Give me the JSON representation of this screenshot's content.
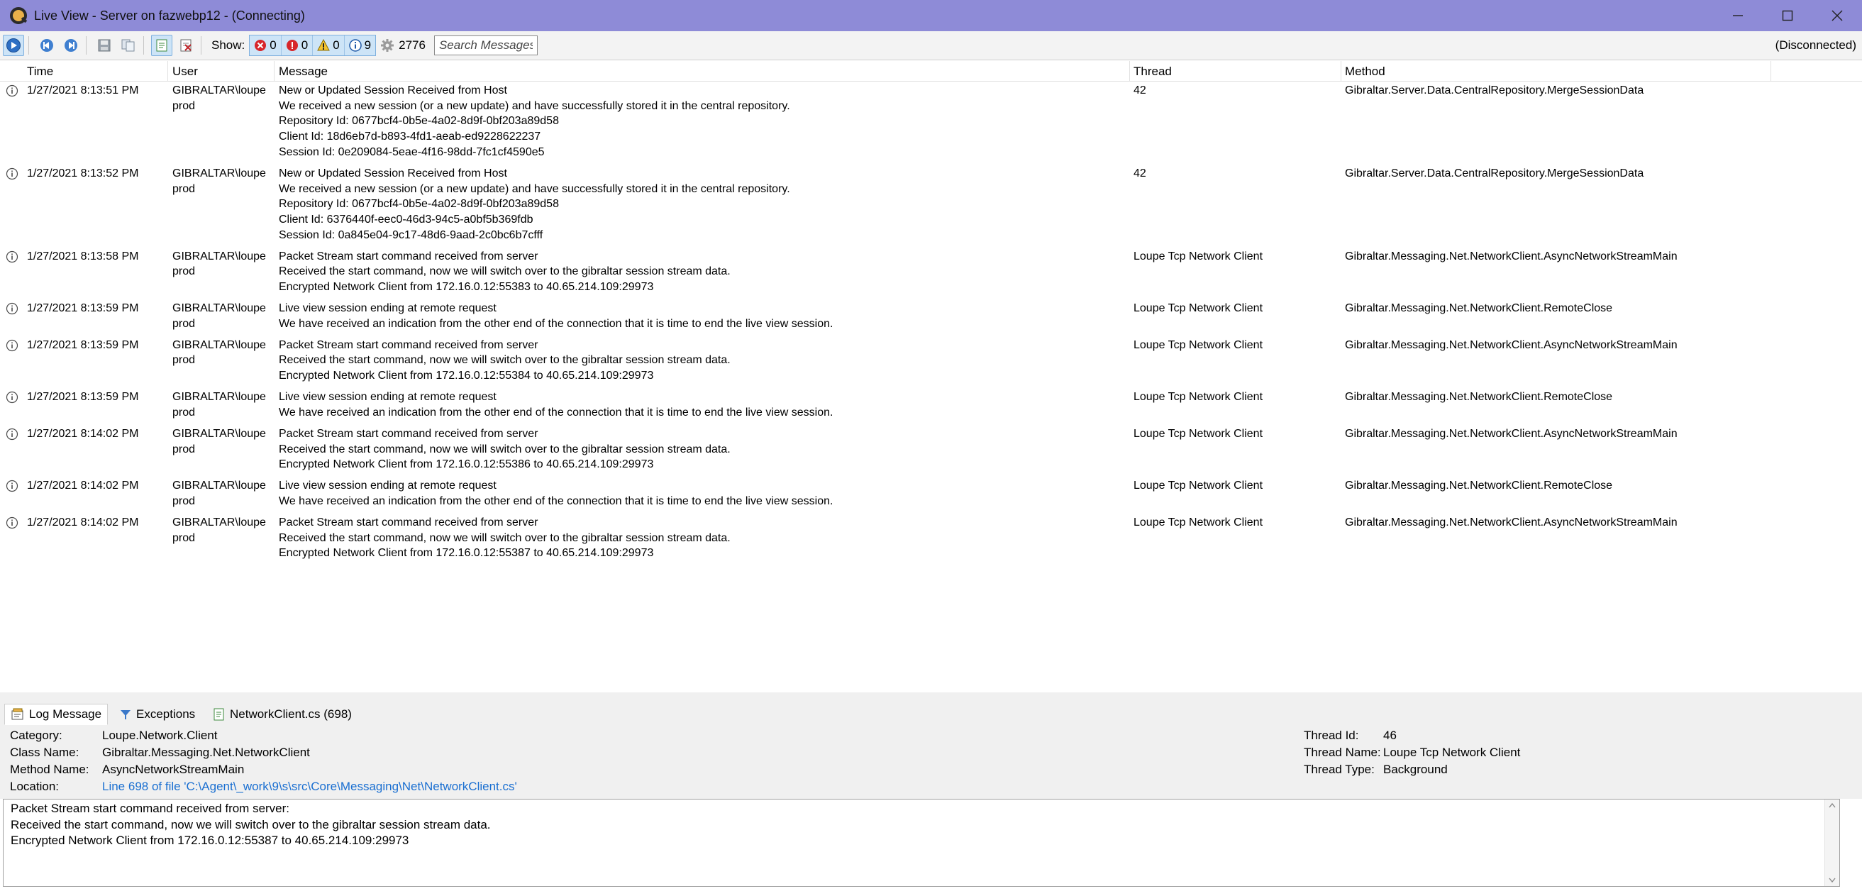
{
  "window": {
    "title": "Live View - Server on fazwebp12 - (Connecting)"
  },
  "toolbar": {
    "show_label": "Show:",
    "filters": {
      "errors": "0",
      "criticals": "0",
      "warnings": "0",
      "info": "9"
    },
    "message_count": "2776",
    "search_placeholder": "Search Messages",
    "status": "(Disconnected)"
  },
  "columns": {
    "time": "Time",
    "user": "User",
    "message": "Message",
    "thread": "Thread",
    "method": "Method"
  },
  "rows": [
    {
      "time": "1/27/2021 8:13:51 PM",
      "user": [
        "GIBRALTAR\\loupe",
        "prod"
      ],
      "message": [
        "New or Updated Session Received from Host",
        "We received a new session (or a new update) and have successfully stored it in the central repository.",
        "Repository Id: 0677bcf4-0b5e-4a02-8d9f-0bf203a89d58",
        "Client Id: 18d6eb7d-b893-4fd1-aeab-ed9228622237",
        "Session Id: 0e209084-5eae-4f16-98dd-7fc1cf4590e5"
      ],
      "thread": "42",
      "method": "Gibraltar.Server.Data.CentralRepository.MergeSessionData"
    },
    {
      "time": "1/27/2021 8:13:52 PM",
      "user": [
        "GIBRALTAR\\loupe",
        "prod"
      ],
      "message": [
        "New or Updated Session Received from Host",
        "We received a new session (or a new update) and have successfully stored it in the central repository.",
        "Repository Id: 0677bcf4-0b5e-4a02-8d9f-0bf203a89d58",
        "Client Id: 6376440f-eec0-46d3-94c5-a0bf5b369fdb",
        "Session Id: 0a845e04-9c17-48d6-9aad-2c0bc6b7cfff"
      ],
      "thread": "42",
      "method": "Gibraltar.Server.Data.CentralRepository.MergeSessionData"
    },
    {
      "time": "1/27/2021 8:13:58 PM",
      "user": [
        "GIBRALTAR\\loupe",
        "prod"
      ],
      "message": [
        "Packet Stream start command received from server",
        "Received the start command, now we will switch over to the gibraltar session stream data.",
        "Encrypted Network Client from 172.16.0.12:55383 to 40.65.214.109:29973"
      ],
      "thread": "Loupe Tcp Network Client",
      "method": "Gibraltar.Messaging.Net.NetworkClient.AsyncNetworkStreamMain"
    },
    {
      "time": "1/27/2021 8:13:59 PM",
      "user": [
        "GIBRALTAR\\loupe",
        "prod"
      ],
      "message": [
        "Live view session ending at remote request",
        "We have received an indication from the other end of the connection that it is time to end the live view session."
      ],
      "thread": "Loupe Tcp Network Client",
      "method": "Gibraltar.Messaging.Net.NetworkClient.RemoteClose"
    },
    {
      "time": "1/27/2021 8:13:59 PM",
      "user": [
        "GIBRALTAR\\loupe",
        "prod"
      ],
      "message": [
        "Packet Stream start command received from server",
        "Received the start command, now we will switch over to the gibraltar session stream data.",
        "Encrypted Network Client from 172.16.0.12:55384 to 40.65.214.109:29973"
      ],
      "thread": "Loupe Tcp Network Client",
      "method": "Gibraltar.Messaging.Net.NetworkClient.AsyncNetworkStreamMain"
    },
    {
      "time": "1/27/2021 8:13:59 PM",
      "user": [
        "GIBRALTAR\\loupe",
        "prod"
      ],
      "message": [
        "Live view session ending at remote request",
        "We have received an indication from the other end of the connection that it is time to end the live view session."
      ],
      "thread": "Loupe Tcp Network Client",
      "method": "Gibraltar.Messaging.Net.NetworkClient.RemoteClose"
    },
    {
      "time": "1/27/2021 8:14:02 PM",
      "user": [
        "GIBRALTAR\\loupe",
        "prod"
      ],
      "message": [
        "Packet Stream start command received from server",
        "Received the start command, now we will switch over to the gibraltar session stream data.",
        "Encrypted Network Client from 172.16.0.12:55386 to 40.65.214.109:29973"
      ],
      "thread": "Loupe Tcp Network Client",
      "method": "Gibraltar.Messaging.Net.NetworkClient.AsyncNetworkStreamMain"
    },
    {
      "time": "1/27/2021 8:14:02 PM",
      "user": [
        "GIBRALTAR\\loupe",
        "prod"
      ],
      "message": [
        "Live view session ending at remote request",
        "We have received an indication from the other end of the connection that it is time to end the live view session."
      ],
      "thread": "Loupe Tcp Network Client",
      "method": "Gibraltar.Messaging.Net.NetworkClient.RemoteClose"
    },
    {
      "time": "1/27/2021 8:14:02 PM",
      "user": [
        "GIBRALTAR\\loupe",
        "prod"
      ],
      "message": [
        "Packet Stream start command received from server",
        "Received the start command, now we will switch over to the gibraltar session stream data.",
        "Encrypted Network Client from 172.16.0.12:55387 to 40.65.214.109:29973"
      ],
      "thread": "Loupe Tcp Network Client",
      "method": "Gibraltar.Messaging.Net.NetworkClient.AsyncNetworkStreamMain"
    }
  ],
  "tabs": {
    "log_message": "Log Message",
    "exceptions": "Exceptions",
    "source_file": "NetworkClient.cs (698)"
  },
  "details": {
    "category_label": "Category:",
    "category": "Loupe.Network.Client",
    "class_label": "Class Name:",
    "class_name": "Gibraltar.Messaging.Net.NetworkClient",
    "method_label": "Method Name:",
    "method_name": "AsyncNetworkStreamMain",
    "location_label": "Location:",
    "location": "Line 698 of file 'C:\\Agent\\_work\\9\\s\\src\\Core\\Messaging\\Net\\NetworkClient.cs'",
    "thread_id_label": "Thread Id:",
    "thread_id": "46",
    "thread_name_label": "Thread Name:",
    "thread_name": "Loupe Tcp Network Client",
    "thread_type_label": "Thread Type:",
    "thread_type": "Background"
  },
  "message_text": [
    "Packet Stream start command received from server:",
    "Received the start command, now we will switch over to the gibraltar session stream data.",
    "Encrypted Network Client from 172.16.0.12:55387 to 40.65.214.109:29973"
  ],
  "icons": {
    "row_icon": "info-icon",
    "accent": "#1a6fd1"
  }
}
